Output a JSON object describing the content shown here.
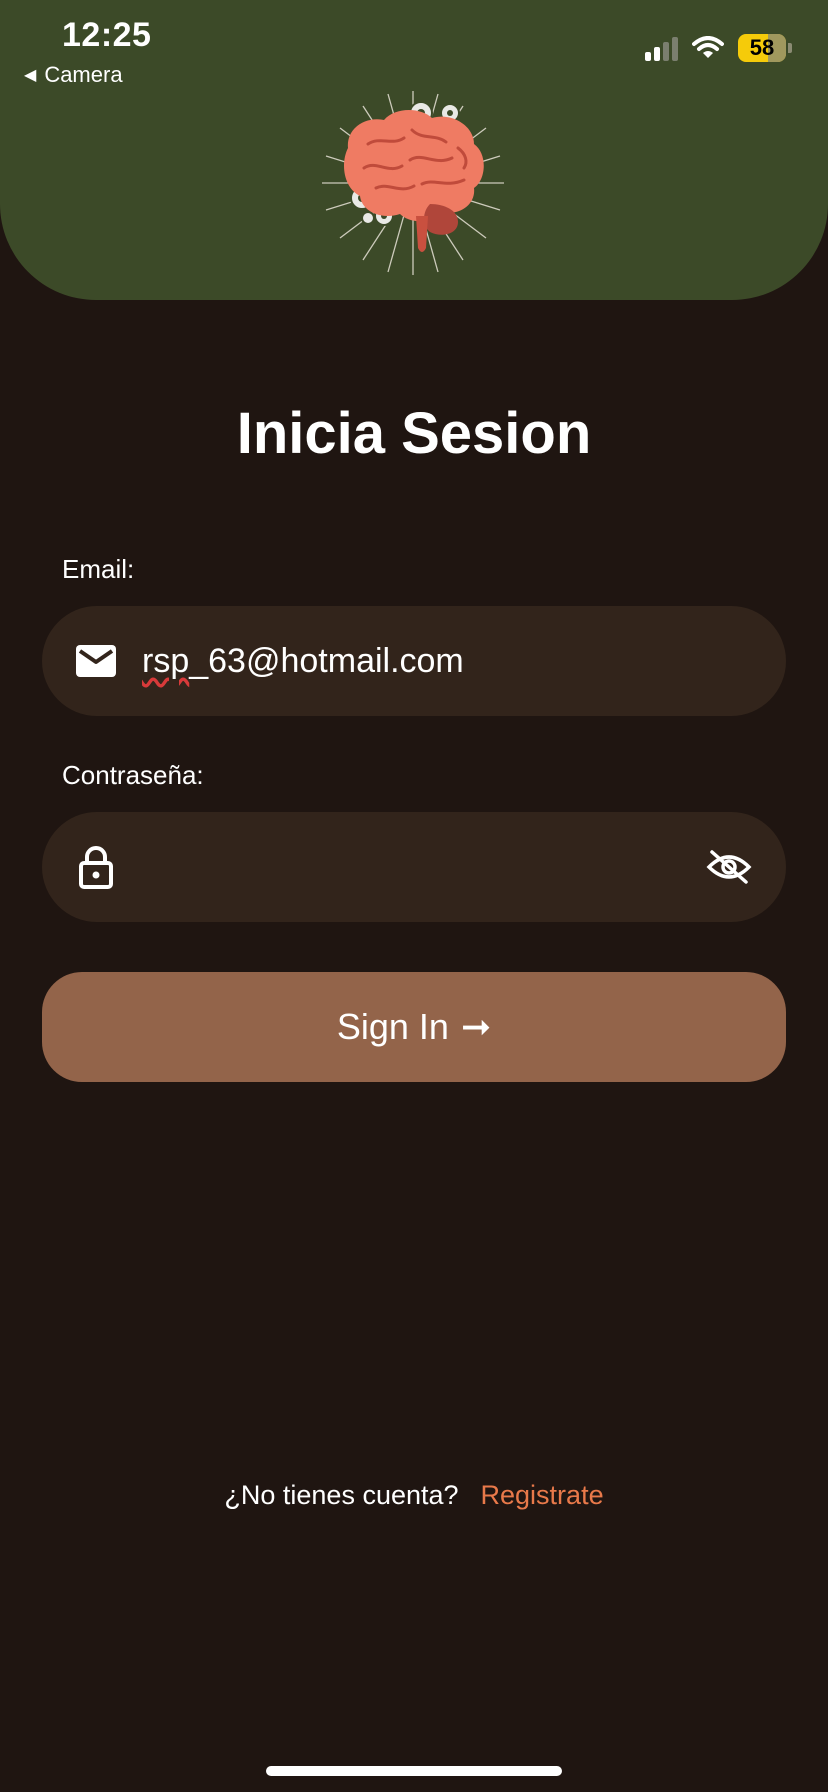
{
  "status_bar": {
    "time": "12:25",
    "back_label": "Camera",
    "battery": "58",
    "signal_bars": 2,
    "signal_total": 4
  },
  "header": {
    "logo_icon": "brain-gears-icon",
    "color": "#3c4a28"
  },
  "title": "Inicia Sesion",
  "email": {
    "label": "Email:",
    "icon": "mail-icon",
    "value_prefix": "rsp",
    "value_rest": "_63@hotmail.com"
  },
  "password": {
    "label": "Contraseña:",
    "icon": "lock-icon",
    "value": "",
    "toggle_icon": "eye-off-icon"
  },
  "signin": {
    "label": "Sign In",
    "arrow": "➞",
    "color": "#93644a"
  },
  "footer": {
    "prompt": "¿No tienes cuenta?",
    "link": "Registrate",
    "link_color": "#e8794a"
  },
  "colors": {
    "background": "#1f1511",
    "input_bg": "#32241b"
  }
}
